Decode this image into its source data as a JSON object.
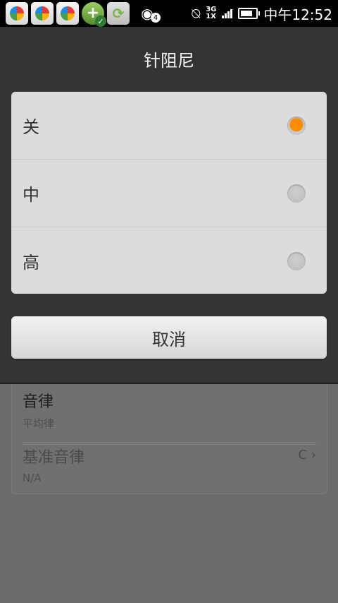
{
  "status_bar": {
    "network": "3G\n1X",
    "chat_badge": "4",
    "time": "中午12:52"
  },
  "dialog": {
    "title": "针阻尼",
    "options": [
      {
        "label": "关",
        "selected": true
      },
      {
        "label": "中",
        "selected": false
      },
      {
        "label": "高",
        "selected": false
      }
    ],
    "cancel_label": "取消"
  },
  "background_settings": {
    "temperament": {
      "title": "音律",
      "value": "平均律"
    },
    "base_temperament": {
      "title": "基准音律",
      "value": "N/A",
      "key": "C"
    }
  },
  "colors": {
    "dialog_bg": "#343434",
    "selected_radio": "#ff8a00"
  }
}
